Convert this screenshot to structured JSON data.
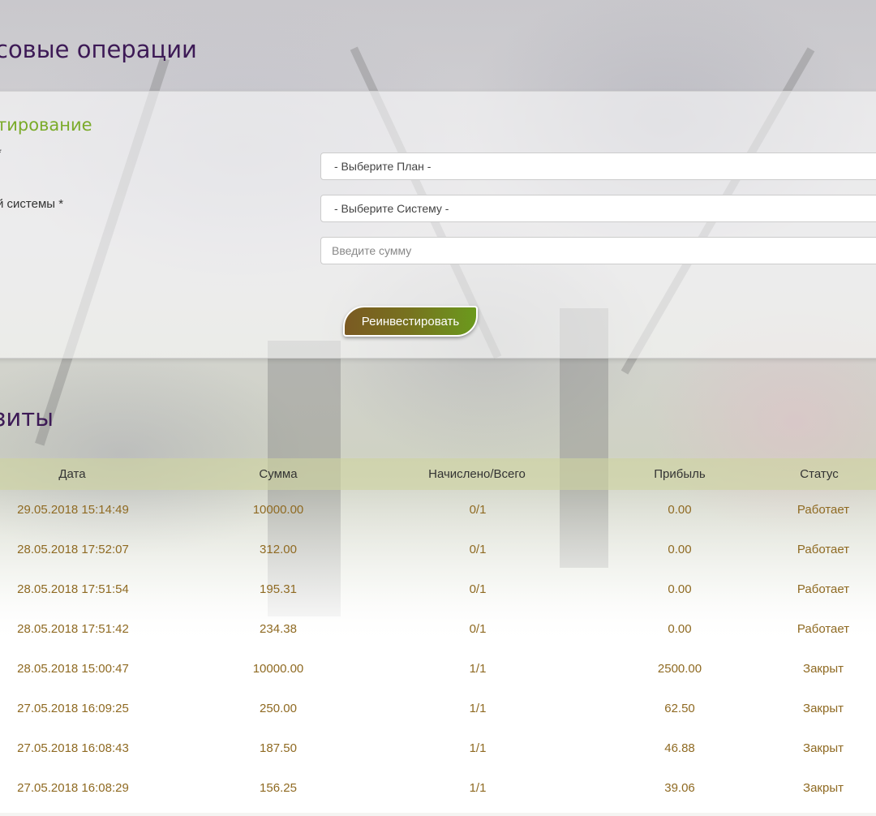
{
  "page": {
    "title": "совые операции"
  },
  "reinvest": {
    "title": "тирование",
    "plan_label": "*",
    "plan_select": "- Выберите План -",
    "system_label": "й системы *",
    "system_select": "- Выберите Систему -",
    "amount_placeholder": "Введите сумму",
    "submit_label": "Реинвестировать"
  },
  "deposits": {
    "title": "зиты",
    "columns": [
      "Дата",
      "Сумма",
      "Начислено/Всего",
      "Прибыль",
      "Статус"
    ],
    "rows": [
      [
        "29.05.2018 15:14:49",
        "10000.00",
        "0/1",
        "0.00",
        "Работает"
      ],
      [
        "28.05.2018 17:52:07",
        "312.00",
        "0/1",
        "0.00",
        "Работает"
      ],
      [
        "28.05.2018 17:51:54",
        "195.31",
        "0/1",
        "0.00",
        "Работает"
      ],
      [
        "28.05.2018 17:51:42",
        "234.38",
        "0/1",
        "0.00",
        "Работает"
      ],
      [
        "28.05.2018 15:00:47",
        "10000.00",
        "1/1",
        "2500.00",
        "Закрыт"
      ],
      [
        "27.05.2018 16:09:25",
        "250.00",
        "1/1",
        "62.50",
        "Закрыт"
      ],
      [
        "27.05.2018 16:08:43",
        "187.50",
        "1/1",
        "46.88",
        "Закрыт"
      ],
      [
        "27.05.2018 16:08:29",
        "156.25",
        "1/1",
        "39.06",
        "Закрыт"
      ]
    ]
  },
  "colors": {
    "heading": "#3d1a56",
    "section_title": "#7bab2a",
    "table_text": "#8f6a22",
    "table_header_bg": "#ced4a0"
  }
}
